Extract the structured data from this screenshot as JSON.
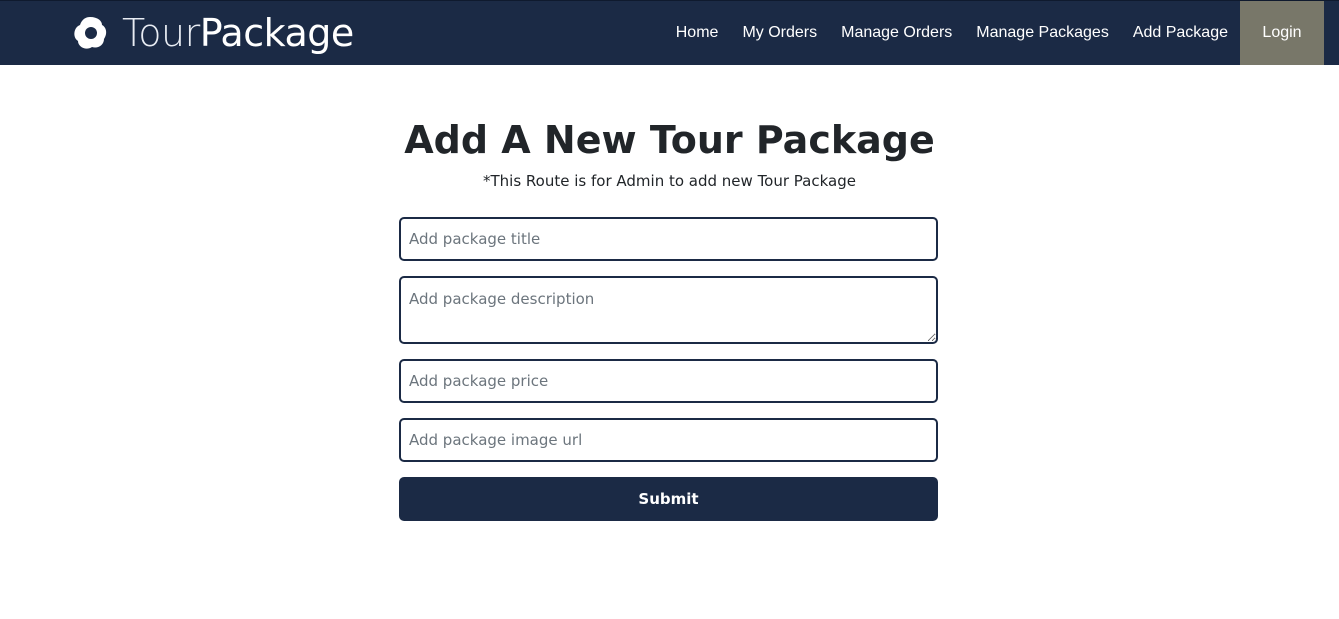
{
  "brand": {
    "name_light": "Tour",
    "name_bold": "Package",
    "logo_icon": "flower-logo-icon"
  },
  "nav": {
    "items": [
      {
        "label": "Home"
      },
      {
        "label": "My Orders"
      },
      {
        "label": "Manage Orders"
      },
      {
        "label": "Manage Packages"
      },
      {
        "label": "Add Package"
      }
    ],
    "login_label": "Login"
  },
  "page": {
    "title": "Add A New Tour Package",
    "subtitle": "*This Route is for Admin to add new Tour Package"
  },
  "form": {
    "title_placeholder": "Add package title",
    "title_value": "",
    "description_placeholder": "Add package description",
    "description_value": "",
    "price_placeholder": "Add package price",
    "price_value": "",
    "image_placeholder": "Add package image url",
    "image_value": "",
    "submit_label": "Submit"
  },
  "colors": {
    "navbar_bg": "#1b2a45",
    "login_bg": "#787769",
    "button_bg": "#1b2a45"
  }
}
